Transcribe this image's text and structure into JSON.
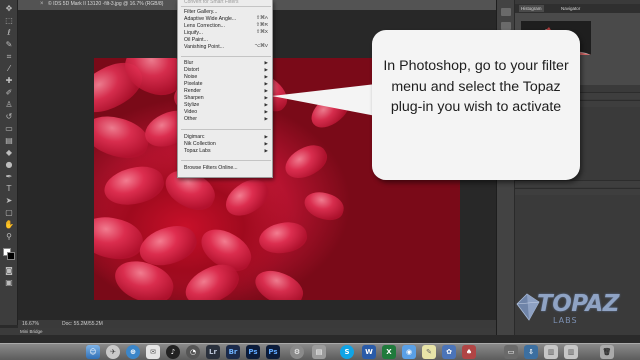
{
  "document": {
    "tab_title": "© IDS 5D Mark II 13120 -filt-3.jpg @ 16.7% (RGB/8)",
    "zoom": "16.67%",
    "doc_size": "Doc: 55.2M/55.2M"
  },
  "mini_bridge": {
    "label": "Mini Bridge"
  },
  "filter_menu": {
    "top_item": "Convert for Smart Filters",
    "items_group1": [
      {
        "label": "Filter Gallery...",
        "shortcut": ""
      },
      {
        "label": "Adaptive Wide Angle...",
        "shortcut": "⇧⌘A"
      },
      {
        "label": "Lens Correction...",
        "shortcut": "⇧⌘R"
      },
      {
        "label": "Liquify...",
        "shortcut": "⇧⌘X"
      },
      {
        "label": "Oil Paint...",
        "shortcut": ""
      },
      {
        "label": "Vanishing Point...",
        "shortcut": "⌥⌘V"
      }
    ],
    "items_group2": [
      {
        "label": "Blur"
      },
      {
        "label": "Distort"
      },
      {
        "label": "Noise"
      },
      {
        "label": "Pixelate"
      },
      {
        "label": "Render"
      },
      {
        "label": "Sharpen"
      },
      {
        "label": "Stylize"
      },
      {
        "label": "Video"
      },
      {
        "label": "Other"
      }
    ],
    "items_group3": [
      {
        "label": "Digimarc"
      },
      {
        "label": "Nik Collection"
      },
      {
        "label": "Topaz Labs"
      }
    ],
    "browse": "Browse Filters Online..."
  },
  "callout": {
    "text": "In Photoshop, go to your filter menu and select the Topaz plug-in you wish to activate"
  },
  "right_panel": {
    "tabs": [
      "Histogram",
      "Navigator"
    ]
  },
  "logo": {
    "name": "TOPAZ",
    "sub": "LABS"
  },
  "colors": {
    "menu_bg": "#ececec",
    "callout_bg": "#f4f4f4",
    "ps_panel": "#3a3a3a",
    "canvas_bg": "#282828"
  },
  "dock": {
    "icons": [
      "finder-icon",
      "launchpad-icon",
      "safari-icon",
      "mail-icon",
      "itunes-icon",
      "lightroom-icon",
      "photoshop-icon",
      "photoshop-icon-2",
      "system-preferences-icon",
      "skype-icon",
      "word-icon",
      "excel-icon",
      "notes-icon",
      "photos-icon",
      "trash-icon"
    ]
  }
}
